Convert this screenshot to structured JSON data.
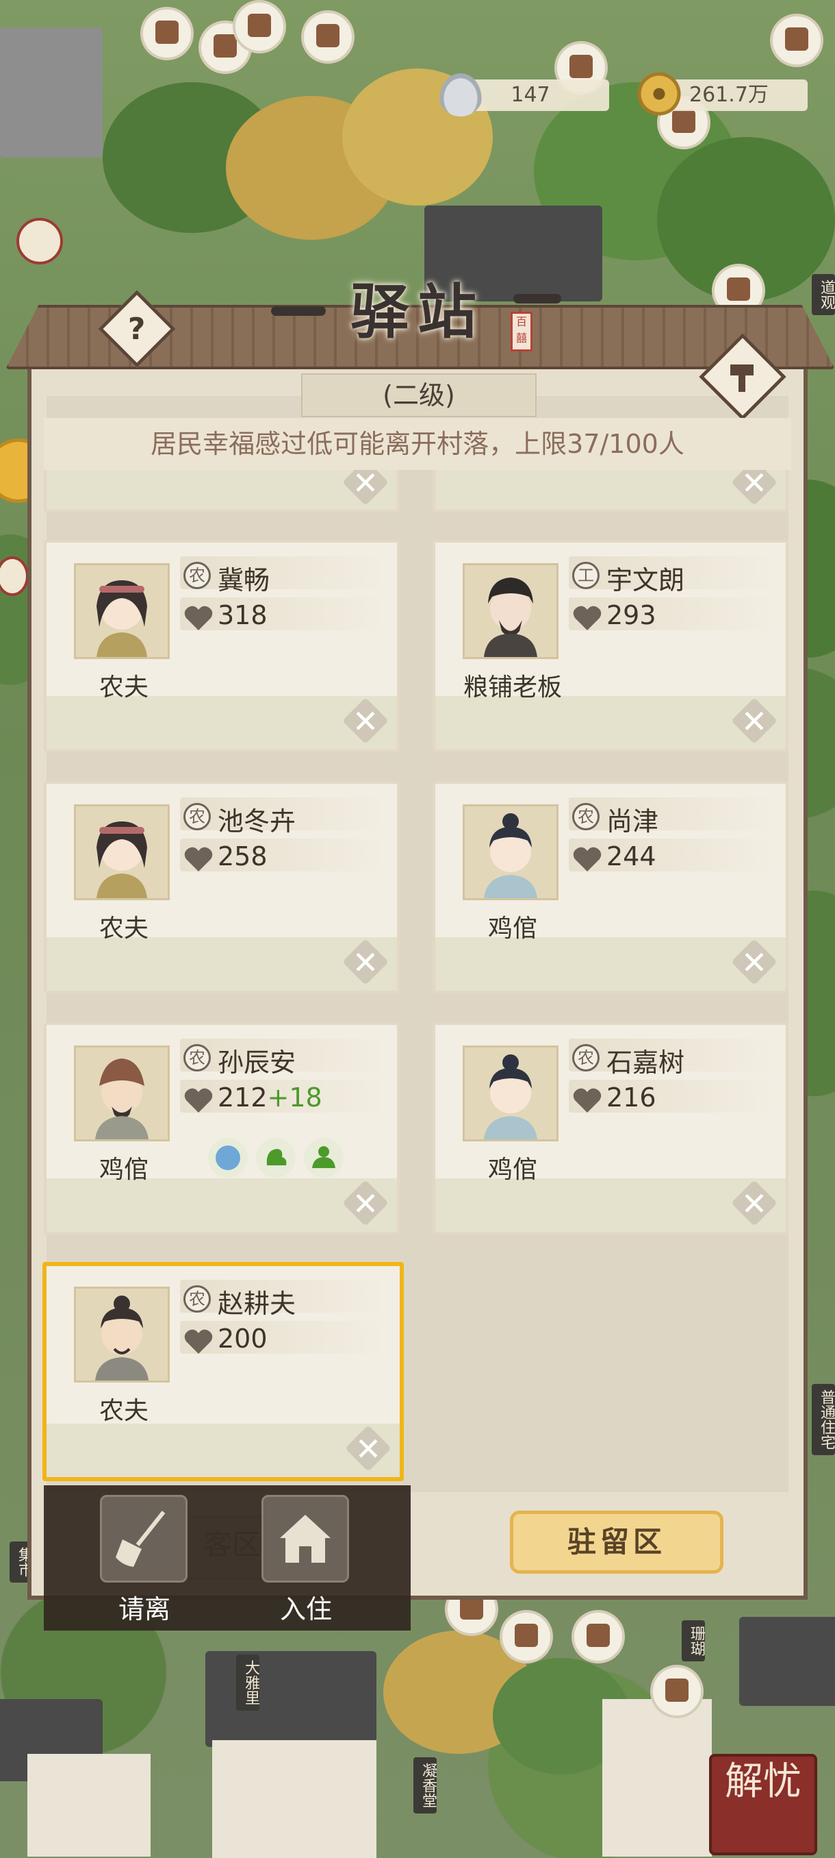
{
  "currency": {
    "silver": "147",
    "coins": "261.7万"
  },
  "panel": {
    "title": "驿站",
    "seal": "百囍",
    "level": "(二级)",
    "notice": "居民幸福感过低可能离开村落，上限37/100人"
  },
  "residents": [
    {
      "name": "冀畅",
      "class_icon": "农",
      "job": "农夫",
      "happiness": "318",
      "bonus": ""
    },
    {
      "name": "宇文朗",
      "class_icon": "工",
      "job": "粮铺老板",
      "happiness": "293",
      "bonus": ""
    },
    {
      "name": "池冬卉",
      "class_icon": "农",
      "job": "农夫",
      "happiness": "258",
      "bonus": ""
    },
    {
      "name": "尚津",
      "class_icon": "农",
      "job": "鸡倌",
      "happiness": "244",
      "bonus": ""
    },
    {
      "name": "孙辰安",
      "class_icon": "农",
      "job": "鸡倌",
      "happiness": "212",
      "bonus": "+18"
    },
    {
      "name": "石嘉树",
      "class_icon": "农",
      "job": "鸡倌",
      "happiness": "216",
      "bonus": ""
    },
    {
      "name": "赵耕夫",
      "class_icon": "农",
      "job": "农夫",
      "happiness": "200",
      "bonus": ""
    }
  ],
  "buttons": {
    "guest_area": "客区",
    "stay_area": "驻留区",
    "dismiss": "请离",
    "move_in": "入住",
    "close_symbol": "✕",
    "help_symbol": "?"
  },
  "map_labels": {
    "daoguan": "道观",
    "putong_zhuzhai": "普通住宅",
    "jishi": "集市",
    "shanhu": "珊瑚",
    "dayali": "大雅里",
    "ningxiangtang": "凝香堂"
  },
  "stamp": "解忧",
  "colors": {
    "selected_border": "#f0b519",
    "bonus_green": "#4c9a2a",
    "notice_text": "#8b6d5c"
  }
}
